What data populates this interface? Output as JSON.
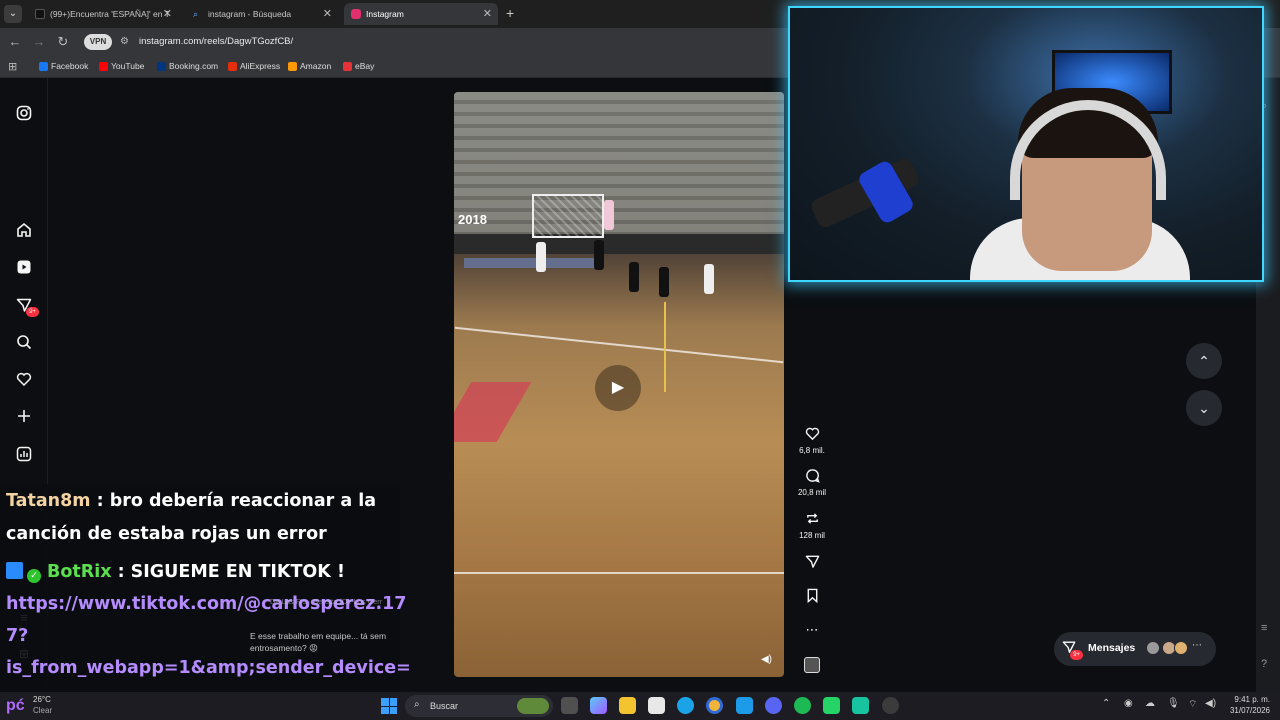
{
  "tabs": [
    {
      "title": "(99+)Encuentra 'ESPAÑA]' en T",
      "favicon_color": "#111111"
    },
    {
      "title": "instagram - Búsqueda",
      "favicon_color": "#3b82f6"
    },
    {
      "title": "Instagram",
      "favicon_color": "#e1306c",
      "active": true
    }
  ],
  "toolbar": {
    "vpn_label": "VPN",
    "url": "instagram.com/reels/DagwTGozfCB/"
  },
  "bookmarks": [
    {
      "label": "Facebook",
      "color": "#1877f2"
    },
    {
      "label": "YouTube",
      "color": "#ff0000"
    },
    {
      "label": "Booking.com",
      "color": "#003580"
    },
    {
      "label": "AliExpress",
      "color": "#e62e04"
    },
    {
      "label": "Amazon",
      "color": "#ff9900"
    },
    {
      "label": "eBay",
      "color": "#e53238"
    }
  ],
  "sidenav": {
    "notif_badge": "9+",
    "icons": [
      "instagram-logo-icon",
      "home-icon",
      "reels-icon",
      "messages-icon",
      "search-icon",
      "heart-icon",
      "create-icon",
      "dashboard-icon",
      "menu-icon",
      "more-icon"
    ]
  },
  "reel": {
    "banner_text": "2018"
  },
  "actions": {
    "likes": "6,8 mil.",
    "comments": "20,8 mil",
    "reposts": "128 mil"
  },
  "messages": {
    "label": "Mensajes",
    "badge": "9+"
  },
  "chat": {
    "line1_user": "Tatan8m",
    "line1_text": " : bro debería reaccionar a la",
    "line2_text": "canción de estaba rojas un error",
    "line3_user": "BotRix",
    "line3_text": " : SIGUEME EN TIKTOK !",
    "line4_link": "https://www.tiktok.com/@carlosperez.17",
    "line5_link": "7?",
    "line6_link": "is_from_webapp=1&amp;sender_device="
  },
  "caption": {
    "ghost_top": "De Las R's · Beretta (De Los Cerr",
    "text": "E esse trabalho em equipe... tá sem entrosamento? 😡"
  },
  "taskbar": {
    "weather_temp": "26°C",
    "weather_desc": "Clear",
    "search_placeholder": "Buscar",
    "time": "9:41 p. m.",
    "date": "31/07/2026"
  },
  "colors": {
    "accent_webcam_border": "#3fd6ff",
    "notif_red": "#ff3040",
    "chat_user1": "#f4d3a2",
    "chat_user2": "#59e04c",
    "chat_link": "#b48cff"
  }
}
